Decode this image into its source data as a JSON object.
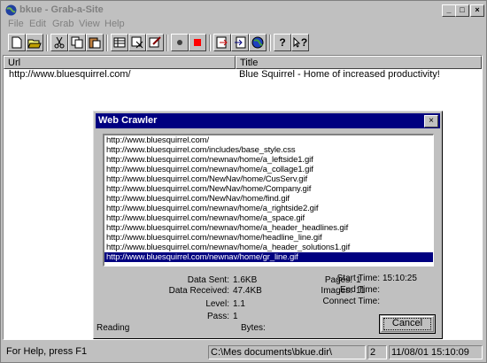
{
  "window": {
    "title": "bkue - Grab-a-Site",
    "minimize_glyph": "_",
    "maximize_glyph": "□",
    "close_glyph": "×"
  },
  "menu": [
    "File",
    "Edit",
    "Grab",
    "View",
    "Help"
  ],
  "toolbar": {
    "buttons": [
      "new-icon",
      "open-icon",
      "cut-icon",
      "copy-icon",
      "paste-icon",
      "grid-icon",
      "filter-icon",
      "settings-icon",
      "record-icon",
      "stop-icon",
      "export-icon",
      "import-icon",
      "globe-icon",
      "help-icon",
      "context-help-icon"
    ],
    "help_glyph": "?",
    "context_help_glyph": "?"
  },
  "list": {
    "columns": [
      "Url",
      "Title"
    ],
    "rows": [
      {
        "url": "http://www.bluesquirrel.com/",
        "title": "Blue Squirrel - Home of increased productivity!"
      }
    ]
  },
  "dialog": {
    "title": "Web Crawler",
    "close_glyph": "×",
    "urls": [
      "http://www.bluesquirrel.com/",
      "http://www.bluesquirrel.com/includes/base_style.css",
      "http://www.bluesquirrel.com/newnav/home/a_leftside1.gif",
      "http://www.bluesquirrel.com/newnav/home/a_collage1.gif",
      "http://www.bluesquirrel.com/NewNav/home/CusServ.gif",
      "http://www.bluesquirrel.com/NewNav/home/Company.gif",
      "http://www.bluesquirrel.com/NewNav/home/find.gif",
      "http://www.bluesquirrel.com/newnav/home/a_rightside2.gif",
      "http://www.bluesquirrel.com/newnav/home/a_space.gif",
      "http://www.bluesquirrel.com/newnav/home/a_header_headlines.gif",
      "http://www.bluesquirrel.com/newnav/home/headline_line.gif",
      "http://www.bluesquirrel.com/newnav/home/a_header_solutions1.gif",
      "http://www.bluesquirrel.com/newnav/home/gr_line.gif"
    ],
    "selected_index": 12,
    "stats": {
      "data_sent_label": "Data Sent:",
      "data_sent": "1.6KB",
      "data_received_label": "Data Received:",
      "data_received": "47.4KB",
      "level_label": "Level:",
      "level": "1.1",
      "pass_label": "Pass:",
      "pass": "1",
      "pages_label": "Pages:",
      "pages": "1",
      "images_label": "Images:",
      "images": "11",
      "start_time_label": "Start Time:",
      "start_time": "15:10:25",
      "end_time_label": "End Time:",
      "connect_time_label": "Connect Time:",
      "reading_label": "Reading",
      "bytes_label": "Bytes:"
    },
    "cancel_label": "Cancel"
  },
  "statusbar": {
    "help": "For Help, press F1",
    "path": "C:\\Mes documents\\bkue.dir\\",
    "count": "2",
    "datetime": "11/08/01 15:10:09"
  },
  "colors": {
    "face": "#c0c0c0",
    "active_title": "#000080",
    "selection": "#000080"
  }
}
